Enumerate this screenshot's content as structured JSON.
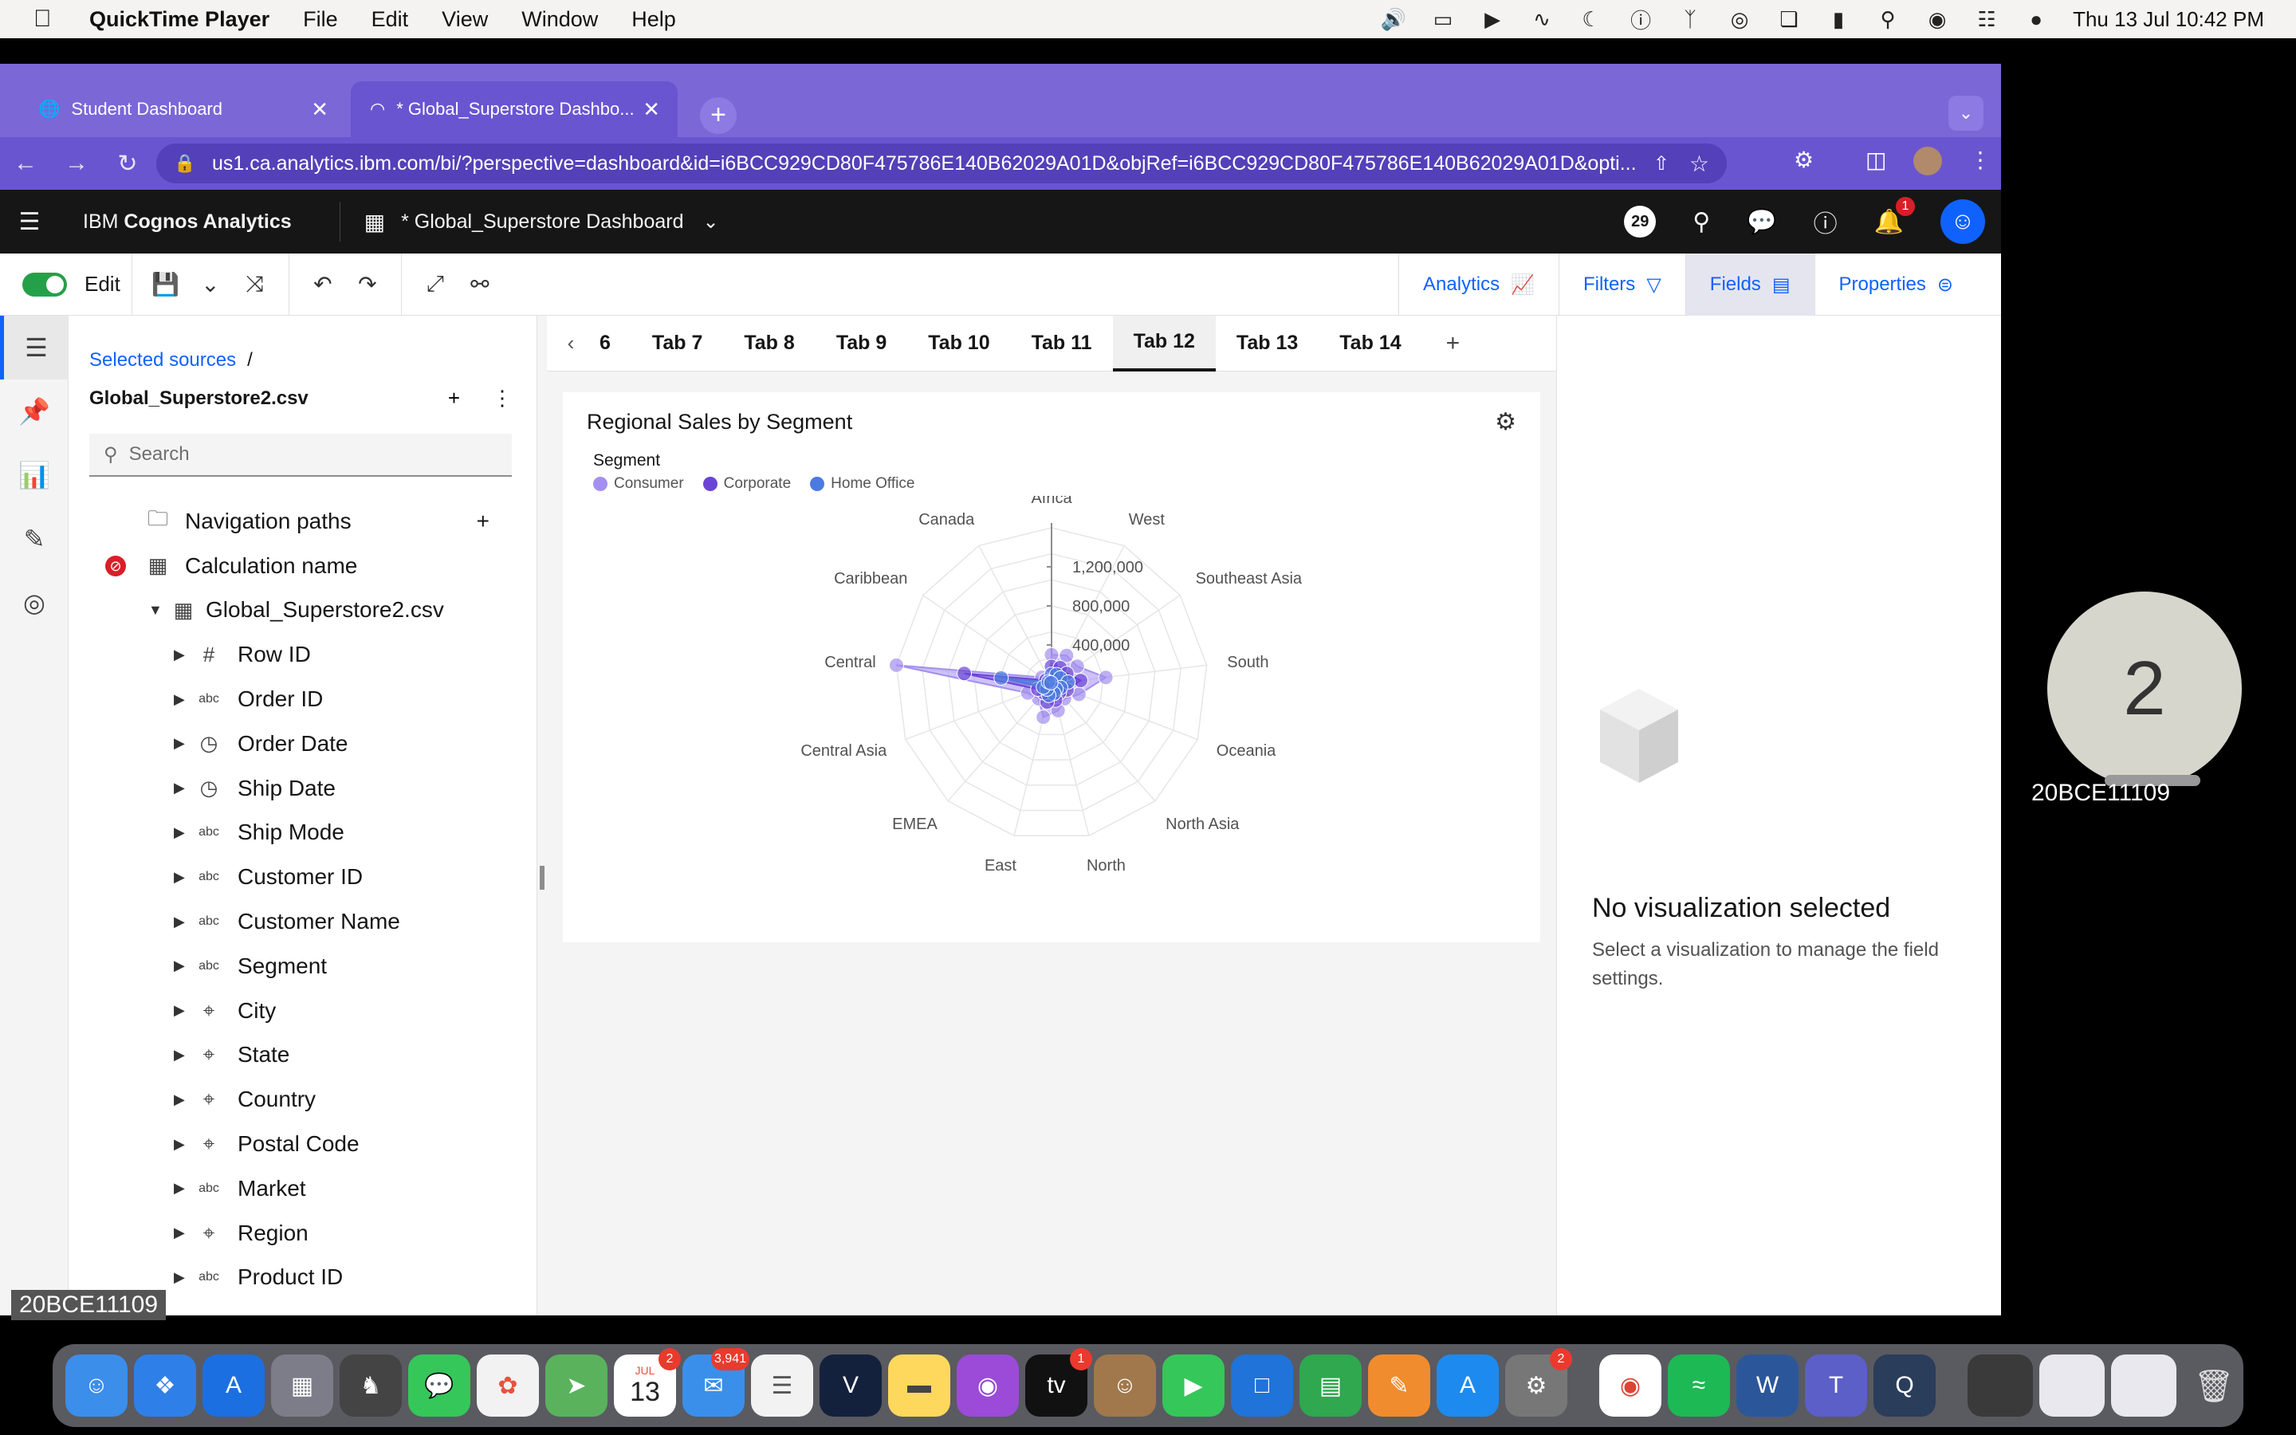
{
  "menubar": {
    "app": "QuickTime Player",
    "items": [
      "File",
      "Edit",
      "View",
      "Window",
      "Help"
    ],
    "datetime": "Thu 13 Jul  10:42 PM"
  },
  "browser": {
    "tabs": [
      {
        "title": "Student Dashboard"
      },
      {
        "title": "* Global_Superstore Dashbo..."
      }
    ],
    "url": "us1.ca.analytics.ibm.com/bi/?perspective=dashboard&id=i6BCC929CD80F475786E140B62029A01D&objRef=i6BCC929CD80F475786E140B62029A01D&opti..."
  },
  "appbar": {
    "brand_prefix": "IBM ",
    "brand_bold": "Cognos Analytics",
    "dashboard_name": "* Global_Superstore Dashboard",
    "count_badge": "29",
    "notif_count": "1"
  },
  "toolbar": {
    "edit_label": "Edit",
    "right": [
      "Analytics",
      "Filters",
      "Fields",
      "Properties"
    ]
  },
  "sources": {
    "breadcrumb": "Selected sources",
    "breadcrumb_sep": "/",
    "source_name": "Global_Superstore2.csv",
    "search_placeholder": "Search",
    "items": [
      {
        "label": "Navigation paths",
        "icon": "folder-icon"
      },
      {
        "label": "Calculation name",
        "icon": "table-icon"
      },
      {
        "label": "Global_Superstore2.csv",
        "icon": "table-icon"
      },
      {
        "label": "Row ID",
        "icon": "#"
      },
      {
        "label": "Order ID",
        "icon": "abc"
      },
      {
        "label": "Order Date",
        "icon": "clock-icon"
      },
      {
        "label": "Ship Date",
        "icon": "clock-icon"
      },
      {
        "label": "Ship Mode",
        "icon": "abc"
      },
      {
        "label": "Customer ID",
        "icon": "abc"
      },
      {
        "label": "Customer Name",
        "icon": "abc"
      },
      {
        "label": "Segment",
        "icon": "abc"
      },
      {
        "label": "City",
        "icon": "pin-icon"
      },
      {
        "label": "State",
        "icon": "pin-icon"
      },
      {
        "label": "Country",
        "icon": "pin-icon"
      },
      {
        "label": "Postal Code",
        "icon": "pin-icon"
      },
      {
        "label": "Market",
        "icon": "abc"
      },
      {
        "label": "Region",
        "icon": "pin-icon"
      },
      {
        "label": "Product ID",
        "icon": "abc"
      }
    ]
  },
  "dashtabs": [
    "6",
    "Tab 7",
    "Tab 8",
    "Tab 9",
    "Tab 10",
    "Tab 11",
    "Tab 12",
    "Tab 13",
    "Tab 14"
  ],
  "viz": {
    "title": "Regional Sales by Segment",
    "legend_title": "Segment"
  },
  "chart_data": {
    "type": "radar",
    "title": "Regional Sales by Segment",
    "legend_title": "Segment",
    "categories": [
      "Africa",
      "West",
      "Southeast Asia",
      "South",
      "Oceania",
      "North Asia",
      "North",
      "East",
      "EMEA",
      "Central Asia",
      "Central",
      "Caribbean",
      "Canada"
    ],
    "radial_ticks": [
      "400,000",
      "800,000",
      "1,200,000"
    ],
    "rmax": 1600000,
    "series": [
      {
        "name": "Consumer",
        "color": "#a48ff0",
        "values": [
          300000,
          330000,
          320000,
          560000,
          300000,
          200000,
          280000,
          350000,
          200000,
          260000,
          1600000,
          120000,
          50000
        ]
      },
      {
        "name": "Corporate",
        "color": "#6b44d6",
        "values": [
          180000,
          190000,
          190000,
          300000,
          170000,
          120000,
          170000,
          190000,
          120000,
          150000,
          900000,
          70000,
          30000
        ]
      },
      {
        "name": "Home Office",
        "color": "#4b7be0",
        "values": [
          100000,
          110000,
          110000,
          170000,
          100000,
          70000,
          100000,
          120000,
          70000,
          90000,
          520000,
          40000,
          15000
        ]
      }
    ]
  },
  "props": {
    "title": "No visualization selected",
    "subtitle": "Select a visualization to manage the field settings."
  },
  "overlay": {
    "participant_number": "2",
    "participant_id": "20BCE11109",
    "corner_id": "20BCE11109"
  },
  "dock": {
    "calendar_month": "JUL",
    "calendar_day": "13",
    "badges": {
      "calendar": "2",
      "mail": "3,941",
      "tv": "1",
      "settings": "2"
    }
  }
}
